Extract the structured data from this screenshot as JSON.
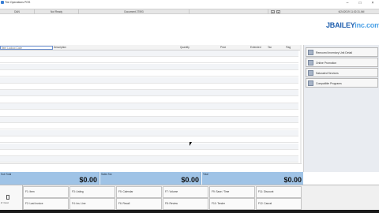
{
  "window": {
    "title": "Tire Operations POS",
    "min_glyph": "–",
    "max_glyph": "□",
    "close_glyph": "×"
  },
  "toolbar": {
    "user": "DAN",
    "status": "Not Ready",
    "order": "Document 27593",
    "datetime": "6/24/2019 11:02:31 AM",
    "nav_prev": "◂",
    "nav_next": "▸"
  },
  "brand": {
    "main": "JBAILEY",
    "sub": "inc.com"
  },
  "grid": {
    "columns": [
      "Description",
      "Quantity",
      "Price",
      "Extended",
      "Tax",
      "Flag"
    ],
    "search_placeholder": "Item Lookup Code",
    "row_count": 17
  },
  "right_panel": {
    "buttons": [
      {
        "label": "Removed Inventory Unit Detail"
      },
      {
        "label": "Online Promotion"
      },
      {
        "label": "Saturated Services"
      },
      {
        "label": "Compatible Programs"
      }
    ]
  },
  "totals": [
    {
      "label": "Sub Total",
      "value": "$0.00"
    },
    {
      "label": "Sales Tax",
      "value": "$0.00"
    },
    {
      "label": "Total",
      "value": "$0.00"
    }
  ],
  "fkeys": {
    "left_label": "Z: Cust",
    "row1": [
      {
        "label": "F1: Item"
      },
      {
        "label": "F3: Listing"
      },
      {
        "label": "F5: Calendar"
      },
      {
        "label": "F7: Volume"
      },
      {
        "label": "F9: Save / Time"
      },
      {
        "label": "F11: Discount"
      }
    ],
    "row2": [
      {
        "label": "F2: Last Invoice"
      },
      {
        "label": "F4: Ins. Line"
      },
      {
        "label": "F6: Recall"
      },
      {
        "label": "F8: Review"
      },
      {
        "label": "F10: Tender"
      },
      {
        "label": "F12: Cancel"
      }
    ]
  }
}
